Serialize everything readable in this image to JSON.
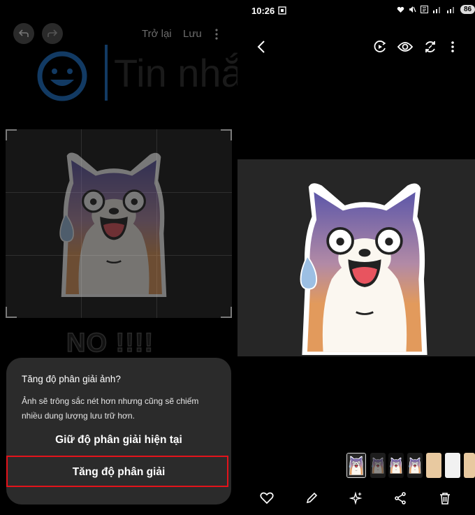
{
  "left": {
    "toolbar": {
      "back_label": "Trở lại",
      "save_label": "Lưu"
    },
    "bg_text": "Tin nhắ",
    "sticker_caption": "NO !!!!",
    "dialog": {
      "title": "Tăng độ phân giải ảnh?",
      "message": "Ảnh sẽ trông sắc nét hơn nhưng cũng sẽ chiếm nhiều dung lượng lưu trữ hơn.",
      "keep_label": "Giữ độ phân giải hiện tại",
      "increase_label": "Tăng độ phân giải"
    }
  },
  "right": {
    "status_bar": {
      "time": "10:26",
      "battery": "86"
    },
    "toolbar_icons": [
      "back-icon",
      "motion-photo-icon",
      "eye-icon",
      "sync-icon",
      "more-icon"
    ],
    "bottom_icons": [
      "heart-icon",
      "pencil-icon",
      "sparkle-icon",
      "share-icon",
      "trash-icon"
    ]
  },
  "colors": {
    "highlight": "#e3131b",
    "dialog_bg": "#2b2b2b",
    "photo_bg": "#262626"
  }
}
